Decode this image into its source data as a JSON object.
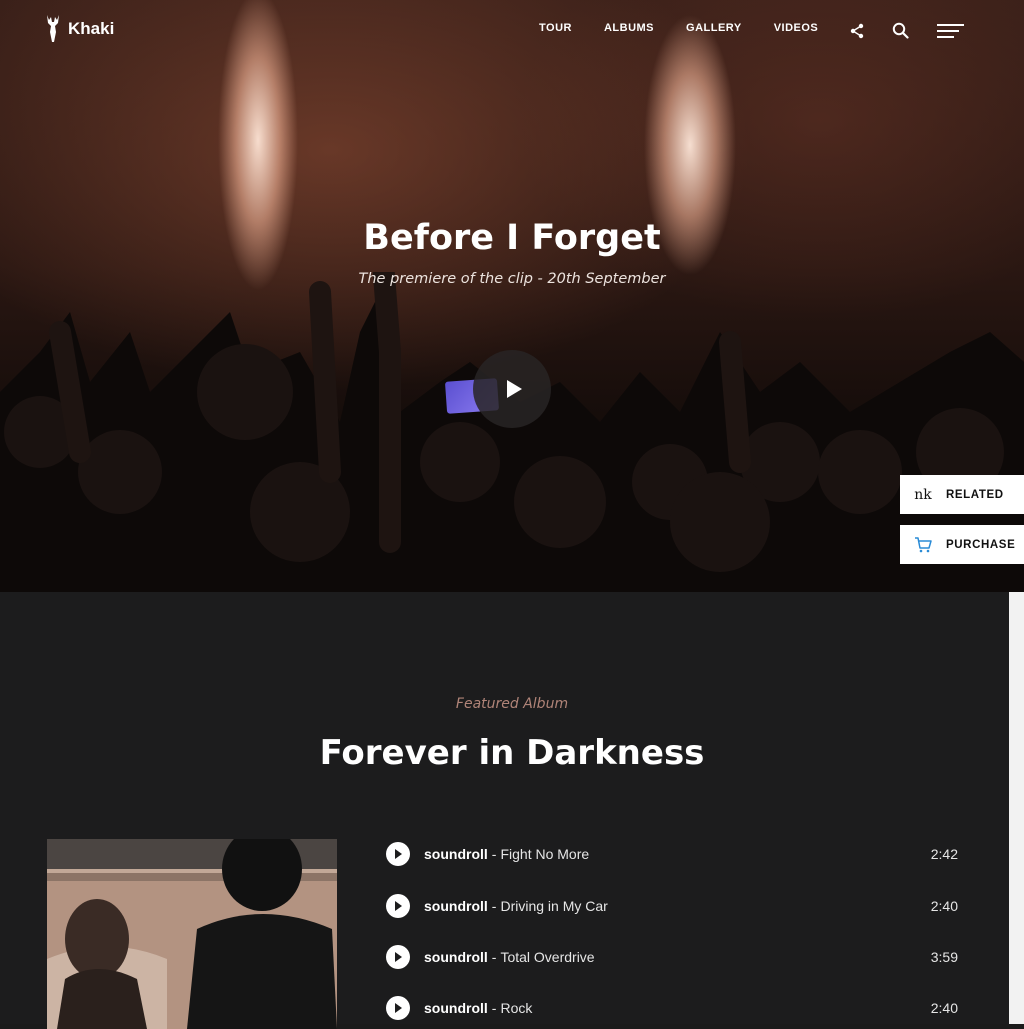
{
  "nav": {
    "logo_text": "Khaki",
    "links": [
      "TOUR",
      "ALBUMS",
      "GALLERY",
      "VIDEOS"
    ],
    "icons": [
      "share-icon",
      "search-icon",
      "menu-icon"
    ]
  },
  "hero": {
    "title": "Before I Forget",
    "subtitle": "The premiere of the clip - 20th September"
  },
  "side_buttons": {
    "related_label": "RELATED",
    "related_icon_text": "nk",
    "purchase_label": "PURCHASE"
  },
  "album": {
    "eyebrow": "Featured Album",
    "title": "Forever in Darkness",
    "tracks": [
      {
        "artist": "soundroll",
        "separator": "-",
        "song": "Fight No More",
        "duration": "2:42"
      },
      {
        "artist": "soundroll",
        "separator": "-",
        "song": "Driving in My Car",
        "duration": "2:40"
      },
      {
        "artist": "soundroll",
        "separator": "-",
        "song": "Total Overdrive",
        "duration": "3:59"
      },
      {
        "artist": "soundroll",
        "separator": "-",
        "song": "Rock",
        "duration": "2:40"
      }
    ]
  },
  "colors": {
    "section_bg": "#1c1c1d",
    "eyebrow": "#b08478",
    "accent_cart": "#2a8bd6"
  }
}
